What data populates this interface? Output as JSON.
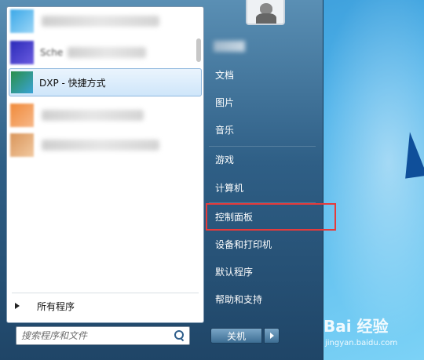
{
  "programs": {
    "selected_label": "DXP - 快捷方式",
    "partial_label": "Sche",
    "all_programs_label": "所有程序"
  },
  "search": {
    "placeholder": "搜索程序和文件"
  },
  "right_menu": {
    "items": [
      "文档",
      "图片",
      "音乐",
      "游戏",
      "计算机",
      "控制面板",
      "设备和打印机",
      "默认程序",
      "帮助和支持"
    ]
  },
  "shutdown": {
    "label": "关机"
  },
  "watermark": {
    "logo_text": "Bai  经验",
    "url": "jingyan.baidu.com"
  },
  "colors": {
    "highlight": "#e53b3b",
    "menu_bg": "#2f5f86"
  },
  "icons": [
    "search-icon",
    "arrow-right-icon",
    "chevron-right-icon",
    "user-icon"
  ]
}
